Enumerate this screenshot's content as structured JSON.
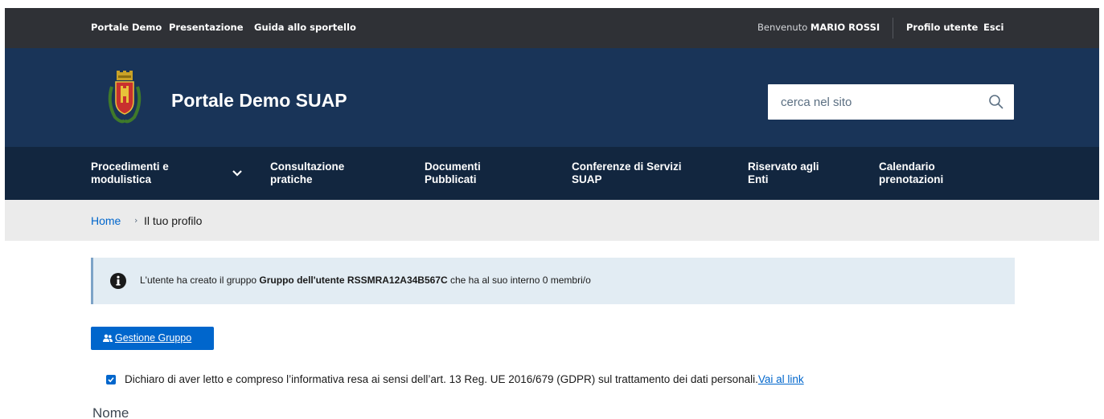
{
  "slim_header": {
    "links": [
      "Portale Demo",
      "Presentazione",
      "Guida allo sportello"
    ],
    "welcome_prefix": "Benvenuto",
    "user_name": "MARIO ROSSI",
    "profile_link": "Profilo utente",
    "logout_link": "Esci"
  },
  "header": {
    "site_title": "Portale Demo SUAP",
    "logo_icon": "coat-of-arms-logo",
    "search_placeholder": "cerca nel sito",
    "search_icon": "search-icon"
  },
  "nav": {
    "items": [
      {
        "line1": "Procedimenti e",
        "line2": "modulistica"
      },
      {
        "line1": "Consultazione",
        "line2": "pratiche"
      },
      {
        "line1": "Documenti",
        "line2": "Pubblicati"
      },
      {
        "line1": "Conferenze di Servizi",
        "line2": "SUAP"
      },
      {
        "line1": "Riservato agli",
        "line2": "Enti"
      },
      {
        "line1": "Calendario",
        "line2": "prenotazioni"
      }
    ]
  },
  "breadcrumb": {
    "home": "Home",
    "separator": "›",
    "current": "Il tuo profilo"
  },
  "alert": {
    "text_before": "L'utente ha creato il gruppo ",
    "group_name": "Gruppo dell'utente RSSMRA12A34B567C",
    "text_after": " che ha al suo interno 0 membri/o"
  },
  "actions": {
    "group_button": "Gestione Gruppo"
  },
  "consent": {
    "checked": true,
    "text": "Dichiaro di aver letto e compreso l’informativa resa ai sensi dell’art. 13 Reg. UE 2016/679 (GDPR) sul trattamento dei dati personali.",
    "link": "Vai al link"
  },
  "form": {
    "name_label": "Nome"
  },
  "colors": {
    "slim_bg": "#2f3136",
    "header_bg": "#193458",
    "nav_bg": "#12263f",
    "primary": "#0066cc",
    "alert_bg": "#e2ecf3"
  }
}
